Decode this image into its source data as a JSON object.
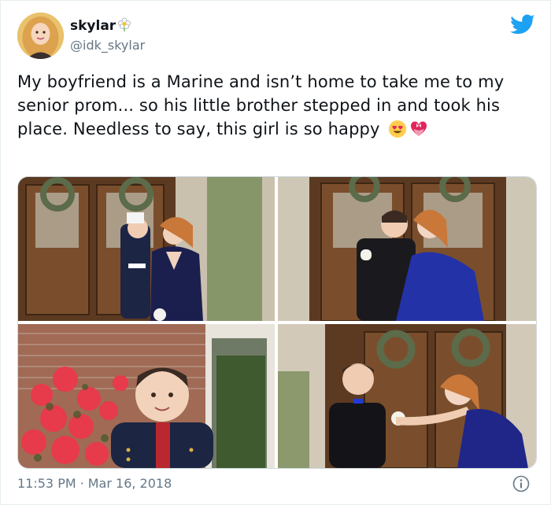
{
  "user": {
    "display_name": "skylar",
    "handle": "@idk_skylar"
  },
  "tweet": {
    "text": "My boyfriend is a Marine and isn’t home to take me to my senior prom... so his little brother stepped in and took his place. Needless to say, this girl is so happy",
    "emojis": [
      "smiling-face-with-heart-eyes",
      "heart-with-ribbon"
    ]
  },
  "timestamp": {
    "time": "11:53 PM",
    "separator": "·",
    "date": "Mar 16, 2018"
  },
  "icons": {
    "name_badge": "flower-icon",
    "brand": "twitter-bird-icon",
    "info": "info-icon"
  },
  "colors": {
    "twitter_blue": "#1da1f2",
    "secondary_text": "#657786",
    "primary_text": "#0f1419"
  }
}
